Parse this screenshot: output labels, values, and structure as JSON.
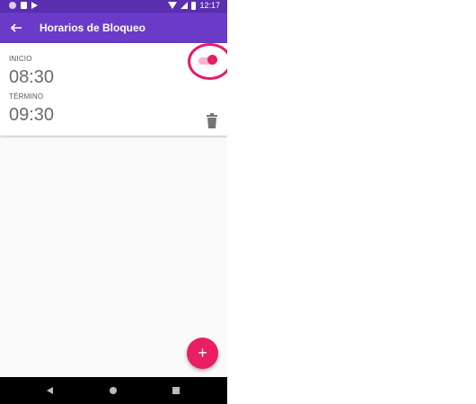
{
  "status_bar": {
    "time": "12:17"
  },
  "app_bar": {
    "title": "Horarios de Bloqueo"
  },
  "schedule": {
    "start_label": "INICIO",
    "start_time": "08:30",
    "end_label": "TÉRMINO",
    "end_time": "09:30",
    "enabled": true
  },
  "fab": {
    "label": "+"
  },
  "colors": {
    "primary": "#6a3bc8",
    "primary_dark": "#5a2fb0",
    "accent": "#e91e63"
  }
}
